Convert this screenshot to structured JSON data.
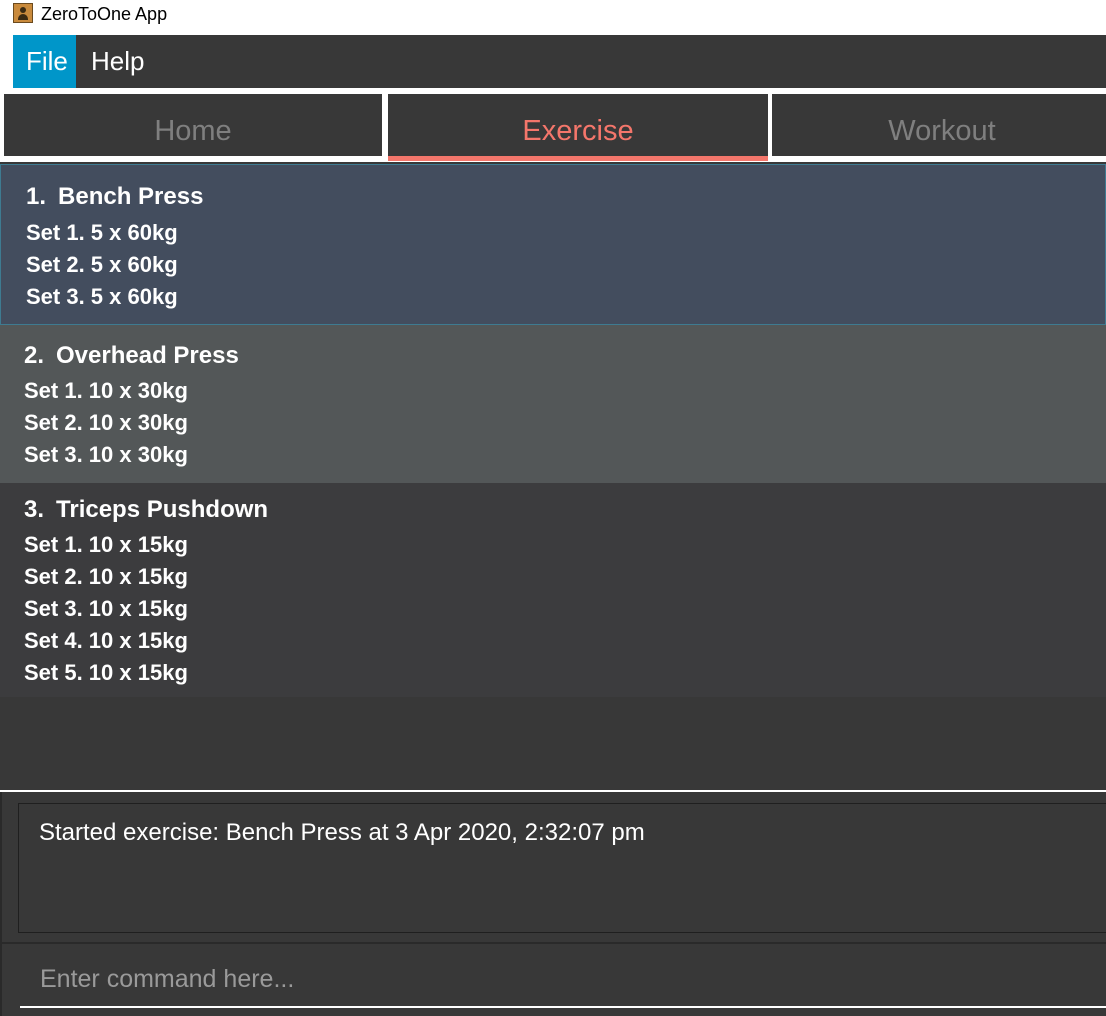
{
  "window": {
    "title": "ZeroToOne App",
    "icon": "contact-book-icon"
  },
  "menu": {
    "items": [
      {
        "label": "File"
      },
      {
        "label": "Help"
      }
    ]
  },
  "tabs": [
    {
      "label": "Home",
      "active": false
    },
    {
      "label": "Exercise",
      "active": true
    },
    {
      "label": "Workout",
      "active": false
    }
  ],
  "exercises": [
    {
      "index": "1.",
      "name": "Bench Press",
      "sets": [
        "Set 1. 5 x 60kg",
        "Set 2. 5 x 60kg",
        "Set 3. 5 x 60kg"
      ]
    },
    {
      "index": "2.",
      "name": "Overhead Press",
      "sets": [
        "Set 1. 10 x 30kg",
        "Set 2. 10 x 30kg",
        "Set 3. 10 x 30kg"
      ]
    },
    {
      "index": "3.",
      "name": "Triceps Pushdown",
      "sets": [
        "Set 1. 10 x 15kg",
        "Set 2. 10 x 15kg",
        "Set 3. 10 x 15kg",
        "Set 4. 10 x 15kg",
        "Set 5. 10 x 15kg"
      ]
    }
  ],
  "result": {
    "text": "Started exercise: Bench Press at 3 Apr 2020, 2:32:07 pm"
  },
  "command": {
    "placeholder": "Enter command here..."
  },
  "colors": {
    "accent": "#f4766b",
    "menu_active": "#0096c9",
    "background": "#383838",
    "selected_card": "#434d5e"
  }
}
